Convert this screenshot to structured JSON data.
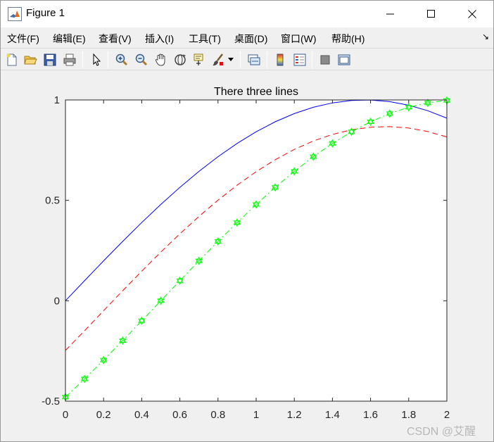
{
  "window": {
    "title": "Figure 1"
  },
  "menu": {
    "items": [
      {
        "label": "文件(F)",
        "name": "menu-file"
      },
      {
        "label": "编辑(E)",
        "name": "menu-edit"
      },
      {
        "label": "查看(V)",
        "name": "menu-view"
      },
      {
        "label": "插入(I)",
        "name": "menu-insert"
      },
      {
        "label": "工具(T)",
        "name": "menu-tools"
      },
      {
        "label": "桌面(D)",
        "name": "menu-desktop"
      },
      {
        "label": "窗口(W)",
        "name": "menu-window"
      },
      {
        "label": "帮助(H)",
        "name": "menu-help"
      }
    ]
  },
  "toolbar": {
    "icons": [
      "new-figure-icon",
      "open-file-icon",
      "save-icon",
      "print-icon",
      "edit-plot-arrow-icon",
      "zoom-in-icon",
      "zoom-out-icon",
      "pan-hand-icon",
      "rotate-3d-icon",
      "data-cursor-icon",
      "brush-icon",
      "brush-dropdown-icon",
      "link-plot-icon",
      "colorbar-icon",
      "legend-icon",
      "hide-plot-tools-icon",
      "show-plot-tools-icon"
    ]
  },
  "watermark": "CSDN @艾醒",
  "colors": {
    "blue": "#0000ff",
    "red": "#ff0000",
    "green": "#00ff00"
  },
  "chart_data": {
    "type": "line",
    "title": "There three lines",
    "xlabel": "",
    "ylabel": "",
    "xlim": [
      0,
      2
    ],
    "ylim": [
      -0.5,
      1
    ],
    "xticks": [
      "0",
      "0.2",
      "0.4",
      "0.6",
      "0.8",
      "1",
      "1.2",
      "1.4",
      "1.6",
      "1.8",
      "2"
    ],
    "yticks": [
      "-0.5",
      "0",
      "0.5",
      "1"
    ],
    "grid": false,
    "series": [
      {
        "style": "solid",
        "color": "#0000ff",
        "marker": "none",
        "x": [
          0,
          0.1,
          0.2,
          0.3,
          0.4,
          0.5,
          0.6,
          0.7,
          0.8,
          0.9,
          1.0,
          1.1,
          1.2,
          1.3,
          1.4,
          1.5,
          1.6,
          1.7,
          1.8,
          1.9,
          2.0
        ],
        "y": [
          0,
          0.0998,
          0.1987,
          0.2955,
          0.3894,
          0.4794,
          0.5646,
          0.6442,
          0.7174,
          0.7833,
          0.8415,
          0.8912,
          0.932,
          0.9636,
          0.9854,
          0.9975,
          0.9996,
          0.9917,
          0.9738,
          0.9463,
          0.9093
        ]
      },
      {
        "style": "dashed",
        "color": "#ff0000",
        "marker": "none",
        "x": [
          0,
          0.1,
          0.2,
          0.3,
          0.4,
          0.5,
          0.6,
          0.7,
          0.8,
          0.9,
          1.0,
          1.1,
          1.2,
          1.3,
          1.4,
          1.5,
          1.6,
          1.7,
          1.8,
          1.9,
          2.0
        ],
        "y": [
          -0.2474,
          -0.1494,
          -0.0494,
          0.0498,
          0.1474,
          0.2423,
          0.3335,
          0.42,
          0.5009,
          0.5755,
          0.6429,
          0.7024,
          0.7535,
          0.7956,
          0.8283,
          0.8513,
          0.8643,
          0.8672,
          0.86,
          0.8428,
          0.8158
        ]
      },
      {
        "style": "dashdot",
        "color": "#00ff00",
        "marker": "hexagram",
        "x": [
          0,
          0.1,
          0.2,
          0.3,
          0.4,
          0.5,
          0.6,
          0.7,
          0.8,
          0.9,
          1.0,
          1.1,
          1.2,
          1.3,
          1.4,
          1.5,
          1.6,
          1.7,
          1.8,
          1.9,
          2.0
        ],
        "y": [
          -0.4794,
          -0.3894,
          -0.2955,
          -0.1987,
          -0.0998,
          0,
          0.0998,
          0.1987,
          0.2955,
          0.3894,
          0.4794,
          0.5646,
          0.6442,
          0.7174,
          0.7833,
          0.8415,
          0.8912,
          0.932,
          0.9636,
          0.9854,
          0.9975
        ]
      }
    ]
  }
}
